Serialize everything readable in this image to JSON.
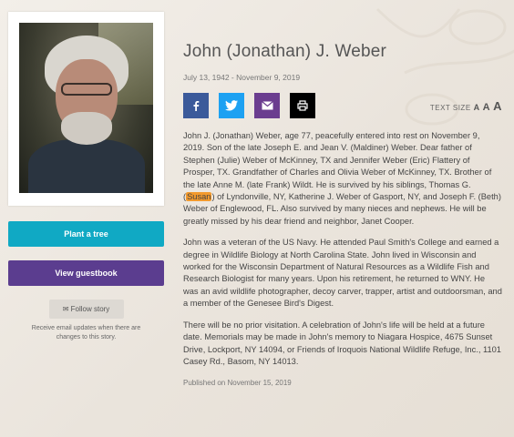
{
  "left": {
    "plant_tree_label": "Plant a tree",
    "view_guestbook_label": "View guestbook",
    "follow_story_label": "Follow story",
    "follow_note": "Receive email updates when there are changes to this story."
  },
  "obituary": {
    "name": "John (Jonathan) J. Weber",
    "dates": "July 13, 1942 - November 9, 2019",
    "text_size_label": "TEXT SIZE",
    "text_size_options": [
      "A",
      "A",
      "A"
    ],
    "paragraphs": {
      "p1_before": "John J. (Jonathan) Weber, age 77, peacefully entered into rest on November 9, 2019. Son of the late Joseph E. and Jean V. (Maldiner) Weber. Dear father of Stephen (Julie) Weber of McKinney, TX and Jennifer Weber (Eric) Flattery of Prosper, TX. Grandfather of Charles and Olivia Weber of McKinney, TX. Brother of the late Anne M. (late Frank) Wildt. He is survived by his siblings, Thomas G. (",
      "p1_highlight": "Susan",
      "p1_after": ") of Lyndonville, NY, Katherine J. Weber of Gasport, NY, and Joseph F. (Beth) Weber of Englewood, FL. Also survived by many nieces and nephews. He will be greatly missed by his dear friend and neighbor, Janet Cooper.",
      "p2": "John was a veteran of the US Navy. He attended Paul Smith's College and earned a degree in Wildlife Biology at North Carolina State. John lived in Wisconsin and worked for the Wisconsin Department of Natural Resources as a Wildlife Fish and Research Biologist for many years. Upon his retirement, he returned to WNY. He was an avid wildlife photographer, decoy carver, trapper, artist and outdoorsman, and a member of the Genesee Bird's Digest.",
      "p3": "There will be no prior visitation. A celebration of John's life will be held at a future date. Memorials may be made in John's memory to Niagara Hospice, 4675 Sunset Drive, Lockport, NY 14094, or Friends of Iroquois National Wildlife Refuge, Inc., 1101 Casey Rd., Basom, NY 14013."
    },
    "published": "Published on November 15, 2019"
  },
  "share": [
    {
      "icon": "facebook-icon",
      "color": "#3b5a9a"
    },
    {
      "icon": "twitter-icon",
      "color": "#1da1f2"
    },
    {
      "icon": "email-icon",
      "color": "#6b3d8f"
    },
    {
      "icon": "print-icon",
      "color": "#000000"
    }
  ],
  "colors": {
    "plant_tree": "#10a9c4",
    "guestbook": "#5b3d8f",
    "highlight": "#f39a2d"
  }
}
